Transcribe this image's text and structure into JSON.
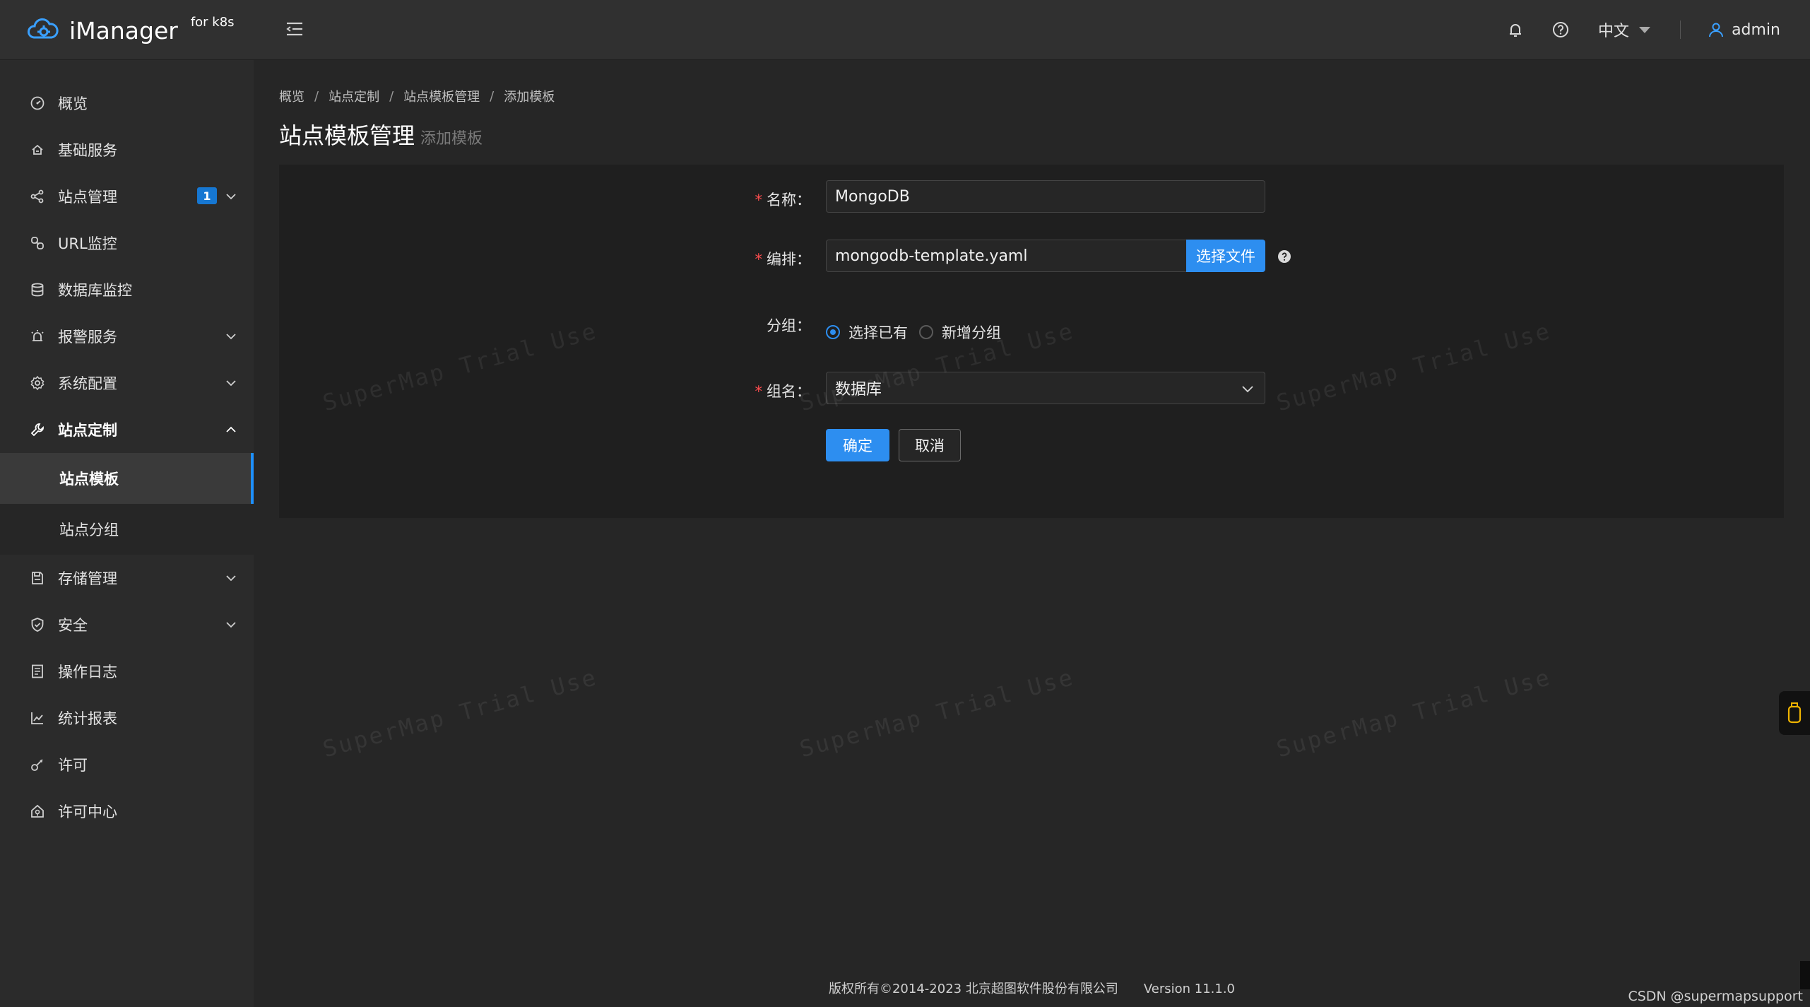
{
  "header": {
    "brand_name": "iManager",
    "brand_suffix": "for k8s",
    "language": "中文",
    "username": "admin",
    "icons": [
      "cloud-logo-icon",
      "menu-fold-icon",
      "bell-icon",
      "question-circle-icon",
      "user-icon"
    ]
  },
  "sidebar": {
    "items": [
      {
        "label": "概览",
        "icon": "dashboard-icon"
      },
      {
        "label": "基础服务",
        "icon": "cloud-service-icon"
      },
      {
        "label": "站点管理",
        "icon": "share-icon",
        "badge": "1"
      },
      {
        "label": "URL监控",
        "icon": "link-monitor-icon"
      },
      {
        "label": "数据库监控",
        "icon": "database-icon"
      },
      {
        "label": "报警服务",
        "icon": "alarm-icon"
      },
      {
        "label": "系统配置",
        "icon": "settings-icon"
      },
      {
        "label": "站点定制",
        "icon": "tool-icon"
      },
      {
        "label": "存储管理",
        "icon": "storage-icon"
      },
      {
        "label": "安全",
        "icon": "shield-icon"
      },
      {
        "label": "操作日志",
        "icon": "log-icon"
      },
      {
        "label": "统计报表",
        "icon": "chart-line-icon"
      },
      {
        "label": "许可",
        "icon": "key-icon"
      },
      {
        "label": "许可中心",
        "icon": "license-center-icon"
      }
    ],
    "sub_items": [
      {
        "label": "站点模板",
        "selected": true
      },
      {
        "label": "站点分组",
        "selected": false
      }
    ]
  },
  "breadcrumb": [
    "概览",
    "站点定制",
    "站点模板管理",
    "添加模板"
  ],
  "page": {
    "title": "站点模板管理",
    "subtitle": "添加模板"
  },
  "form": {
    "name_label": "名称：",
    "name_value": "MongoDB",
    "compose_label": "编排：",
    "compose_value": "mongodb-template.yaml",
    "choose_file_label": "选择文件",
    "group_label": "分组：",
    "group_options": [
      "选择已有",
      "新增分组"
    ],
    "group_selected": "选择已有",
    "group_name_label": "组名：",
    "group_name_value": "数据库",
    "confirm_label": "确定",
    "cancel_label": "取消"
  },
  "footer": {
    "copyright": "版权所有©2014-2023 北京超图软件股份有限公司",
    "version": "Version 11.1.0"
  },
  "overlay_credit": "CSDN @supermapsupport",
  "watermark_text": "SuperMap Trial Use",
  "colors": {
    "accent": "#2d8ef0",
    "background": "#262626",
    "sidebar": "#2b2b2b",
    "header": "#303030",
    "required": "#ff4d4f"
  }
}
